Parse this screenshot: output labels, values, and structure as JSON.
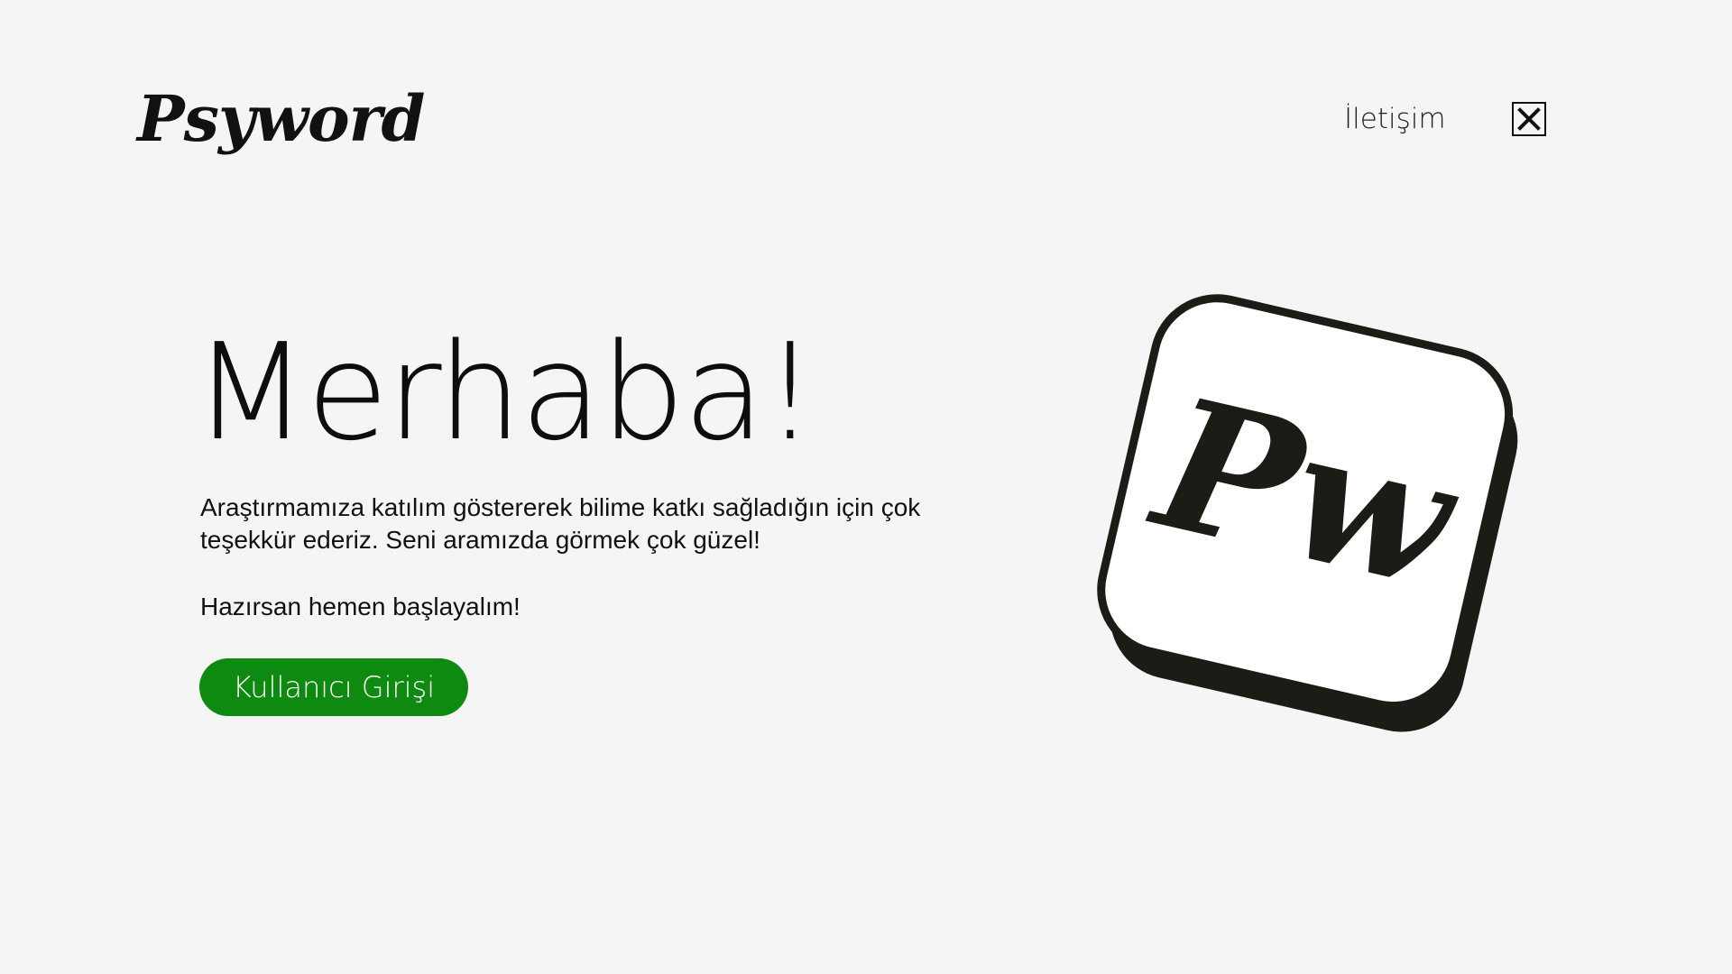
{
  "header": {
    "logo_text": "Psyword",
    "nav_contact": "İletişim",
    "close_icon": "close-icon"
  },
  "hero": {
    "title": "Merhaba!",
    "paragraph": "Araştırmamıza katılım göstererek bilime katkı sağladığın için çok teşekkür ederiz. Seni aramızda görmek çok güzel!",
    "ready_text": "Hazırsan hemen başlayalım!",
    "login_button": "Kullanıcı Girişi"
  },
  "badge": {
    "logo_text": "Pw",
    "icon": "psyword-app-icon"
  },
  "colors": {
    "background": "#f5f5f5",
    "accent": "#0e8a10",
    "text": "#111111"
  }
}
